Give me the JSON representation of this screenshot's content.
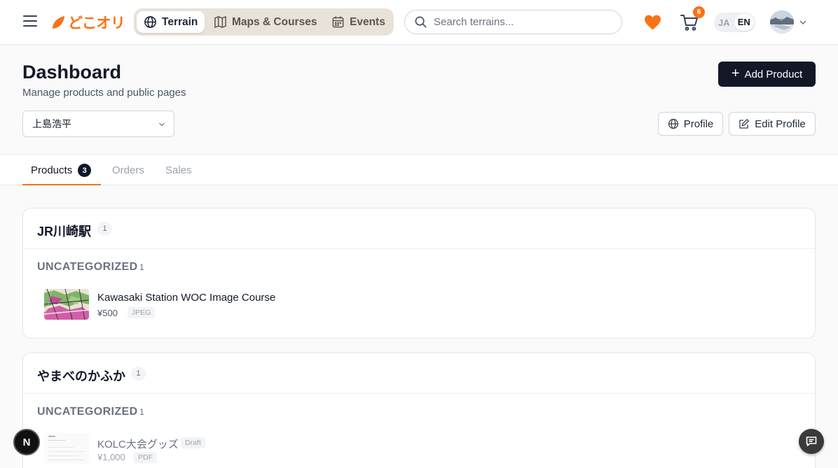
{
  "header": {
    "logo_text": "どこオリ",
    "nav": [
      {
        "label": "Terrain",
        "icon": "globe-icon",
        "active": true
      },
      {
        "label": "Maps & Courses",
        "icon": "map-icon",
        "active": false
      },
      {
        "label": "Events",
        "icon": "calendar-icon",
        "active": false
      }
    ],
    "search_placeholder": "Search terrains...",
    "cart_count": "6",
    "lang": {
      "ja": "JA",
      "en": "EN",
      "selected": "EN"
    }
  },
  "page": {
    "title": "Dashboard",
    "subtitle": "Manage products and public pages",
    "add_product_label": "Add Product",
    "store_selected": "上島浩平",
    "profile_label": "Profile",
    "edit_profile_label": "Edit Profile"
  },
  "tabs": [
    {
      "label": "Products",
      "badge": "3",
      "active": true
    },
    {
      "label": "Orders",
      "active": false
    },
    {
      "label": "Sales",
      "active": false
    }
  ],
  "groups": [
    {
      "title": "JR川崎駅",
      "count": "1",
      "category": "UNCATEGORIZED",
      "category_count": "1",
      "product": {
        "name": "Kawasaki Station WOC Image Course",
        "price": "¥500",
        "format": "JPEG",
        "draft": ""
      }
    },
    {
      "title": "やまべのかふか",
      "count": "1",
      "category": "UNCATEGORIZED",
      "category_count": "1",
      "product": {
        "name": "KOLC大会グッズ",
        "price": "¥1,000",
        "format": "PDF",
        "draft": "Draft"
      }
    }
  ],
  "floating": {
    "dev_badge": "N"
  },
  "colors": {
    "accent": "#f97316",
    "primary_button": "#111827",
    "nav_pill_bg": "#e9e2d9"
  }
}
